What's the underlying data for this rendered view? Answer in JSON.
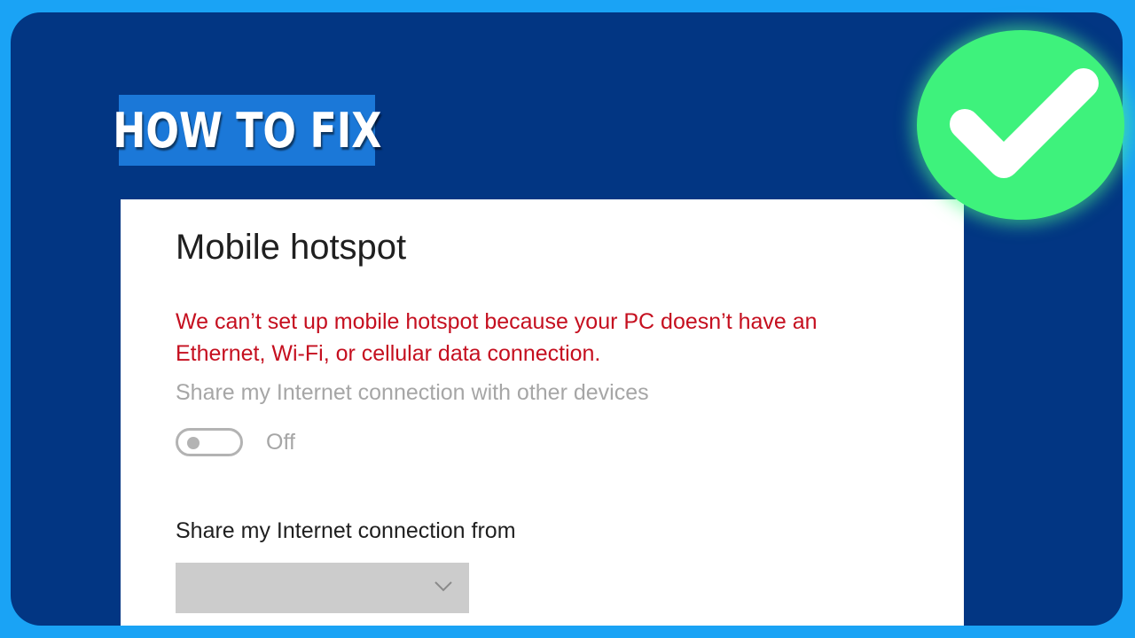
{
  "banner": {
    "text": "HOW TO FIX"
  },
  "badge": {
    "icon": "checkmark-icon",
    "color": "#3ef27c"
  },
  "settings": {
    "title": "Mobile hotspot",
    "error_line1": "We can’t set up mobile hotspot because your PC doesn’t have an",
    "error_line2": "Ethernet, Wi-Fi, or cellular data connection.",
    "share_label": "Share my Internet connection with other devices",
    "toggle_state": "Off",
    "from_label": "Share my Internet connection from",
    "dropdown_value": "",
    "dropdown_icon": "chevron-down-icon"
  },
  "colors": {
    "frame_border": "#1aa3f5",
    "background": "#023683",
    "banner": "#1b78d8",
    "error": "#c50f1f"
  }
}
